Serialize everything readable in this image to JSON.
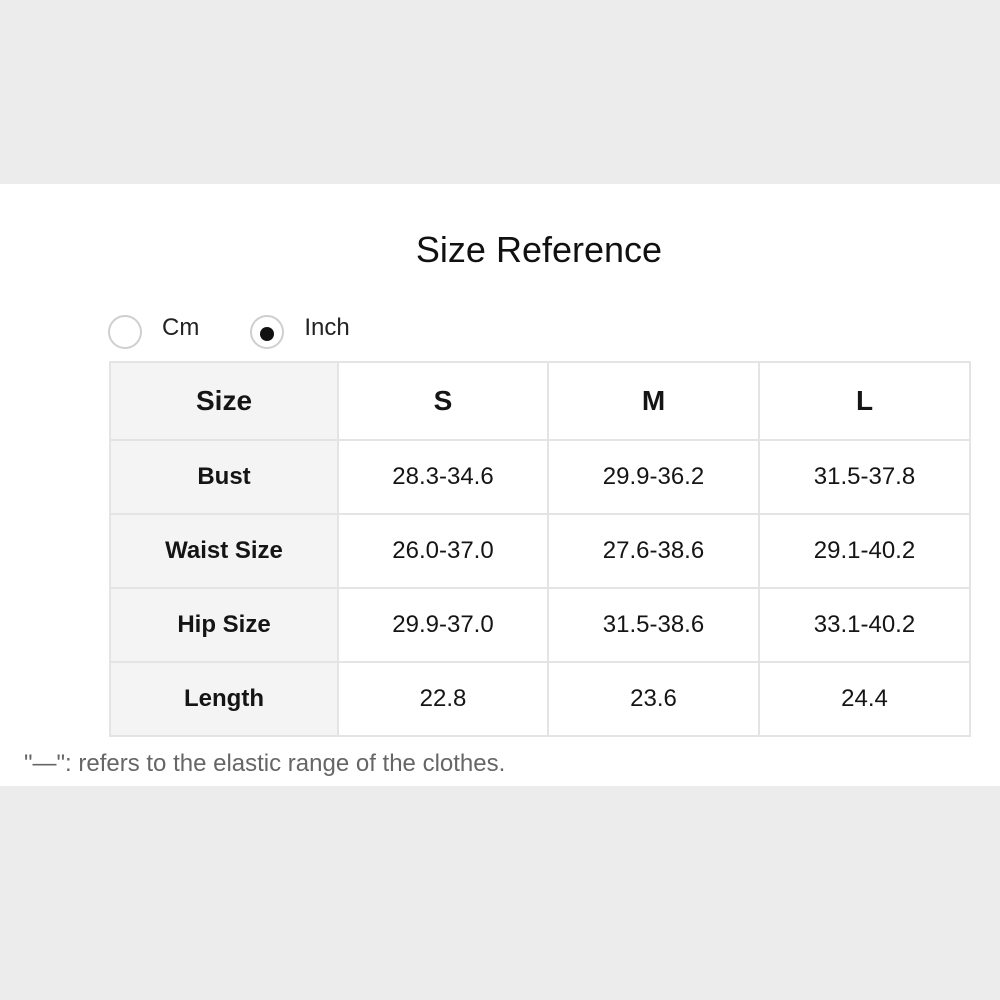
{
  "title": "Size Reference",
  "units": {
    "options": [
      {
        "label": "Cm",
        "selected": false
      },
      {
        "label": "Inch",
        "selected": true
      }
    ]
  },
  "table": {
    "headers": [
      "Size",
      "S",
      "M",
      "L"
    ],
    "rows": [
      {
        "label": "Bust",
        "values": [
          "28.3-34.6",
          "29.9-36.2",
          "31.5-37.8"
        ]
      },
      {
        "label": "Waist Size",
        "values": [
          "26.0-37.0",
          "27.6-38.6",
          "29.1-40.2"
        ]
      },
      {
        "label": "Hip Size",
        "values": [
          "29.9-37.0",
          "31.5-38.6",
          "33.1-40.2"
        ]
      },
      {
        "label": "Length",
        "values": [
          "22.8",
          "23.6",
          "24.4"
        ]
      }
    ]
  },
  "note": "\"—\": refers to the elastic range of the clothes.",
  "colors": {
    "page_background": "#ececec",
    "panel_background": "#ffffff",
    "label_cell_background": "#f4f4f4",
    "border": "#e4e4e4",
    "note_text": "#666666"
  }
}
